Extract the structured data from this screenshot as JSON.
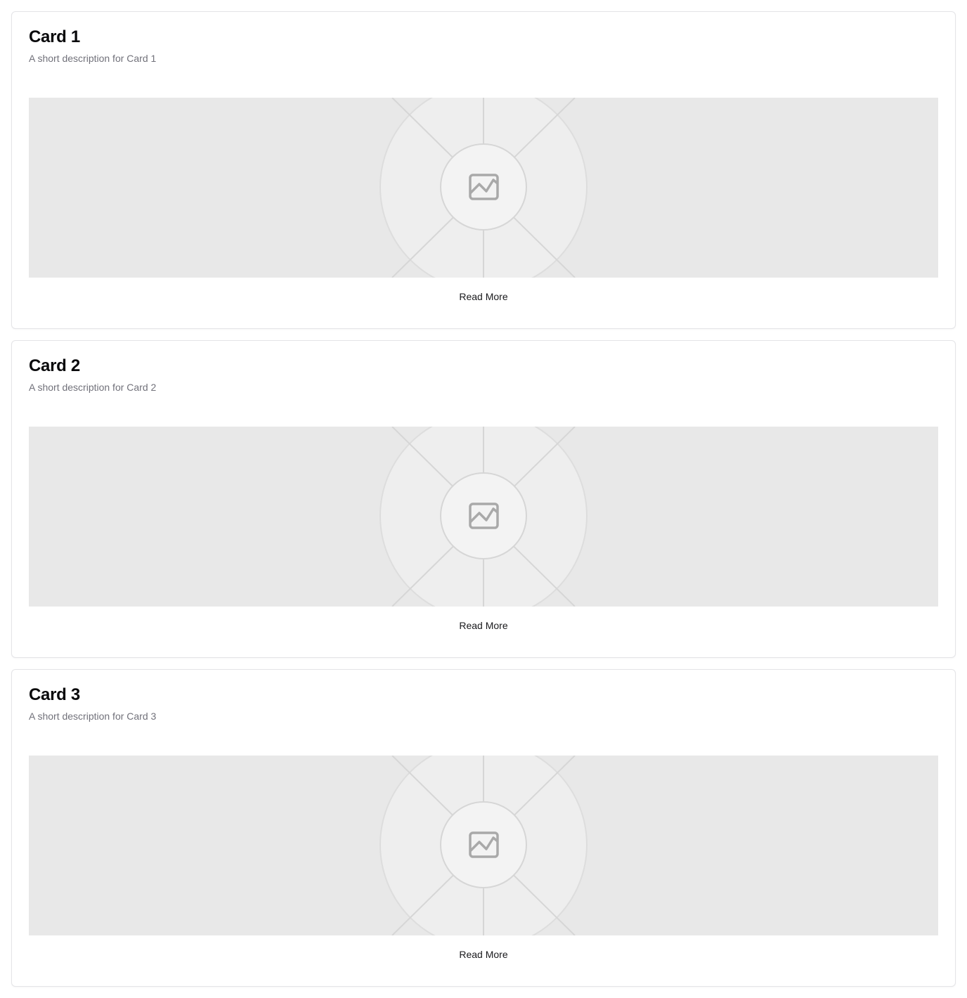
{
  "cards": [
    {
      "title": "Card 1",
      "description": "A short description for Card 1",
      "image_icon": "image-placeholder-icon",
      "button_label": "Read More"
    },
    {
      "title": "Card 2",
      "description": "A short description for Card 2",
      "image_icon": "image-placeholder-icon",
      "button_label": "Read More"
    },
    {
      "title": "Card 3",
      "description": "A short description for Card 3",
      "image_icon": "image-placeholder-icon",
      "button_label": "Read More"
    }
  ],
  "colors": {
    "border": "#e4e4e7",
    "title": "#09090b",
    "description": "#71717a",
    "placeholder_bg": "#e8e8e8"
  }
}
